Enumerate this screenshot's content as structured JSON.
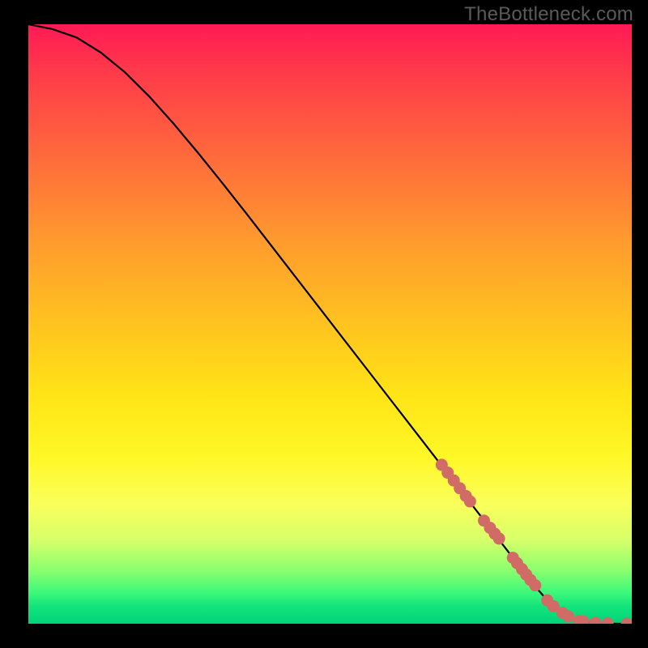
{
  "watermark": {
    "text": "TheBottleneck.com"
  },
  "colors": {
    "background": "#000000",
    "curve": "#000000",
    "dot_fill": "#d16b66",
    "dot_stroke": "#9c4a46"
  },
  "chart_data": {
    "type": "line",
    "title": "",
    "xlabel": "",
    "ylabel": "",
    "xlim": [
      0,
      100
    ],
    "ylim": [
      0,
      100
    ],
    "annotations": [],
    "series": [
      {
        "name": "curve",
        "style": "solid-black-thin",
        "x": [
          0,
          4,
          8,
          12,
          16,
          20,
          24,
          28,
          32,
          36,
          40,
          44,
          48,
          52,
          56,
          60,
          64,
          68,
          72,
          76,
          80,
          84,
          86,
          88,
          90,
          92,
          94,
          96,
          98,
          100
        ],
        "y": [
          100,
          99.2,
          97.8,
          95.3,
          92.0,
          88.0,
          83.5,
          78.7,
          73.7,
          68.6,
          63.4,
          58.2,
          53.0,
          47.8,
          42.6,
          37.4,
          32.2,
          27.0,
          21.8,
          16.6,
          11.4,
          6.2,
          3.9,
          2.2,
          1.0,
          0.35,
          0.1,
          0.03,
          0.0,
          0.0
        ]
      },
      {
        "name": "dots",
        "style": "salmon-markers",
        "x": [
          68.5,
          69.5,
          70.5,
          71.5,
          72.5,
          73.2,
          75.5,
          76.5,
          77.3,
          78.0,
          80.3,
          81.0,
          81.8,
          82.5,
          83.2,
          84.0,
          86.0,
          87.0,
          88.5,
          89.5,
          91.3,
          92.0,
          94.0,
          96.0,
          99.2
        ],
        "y": [
          26.5,
          25.2,
          23.9,
          22.6,
          21.3,
          20.4,
          17.2,
          16.0,
          15.0,
          14.2,
          11.0,
          10.1,
          9.1,
          8.2,
          7.3,
          6.4,
          3.9,
          2.9,
          1.8,
          1.2,
          0.45,
          0.35,
          0.12,
          0.05,
          0.0
        ]
      }
    ]
  }
}
